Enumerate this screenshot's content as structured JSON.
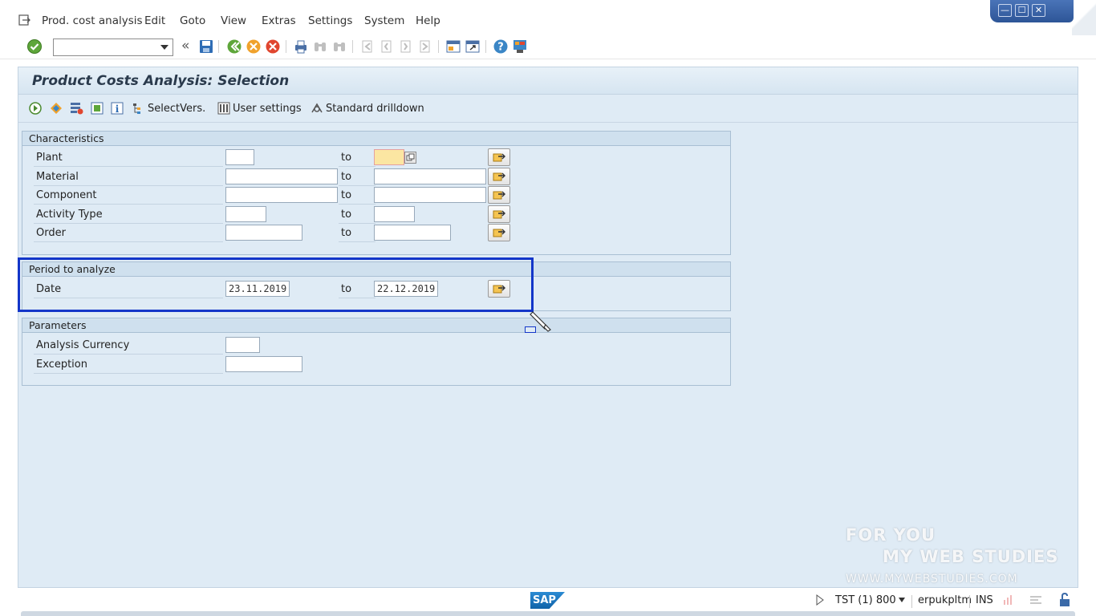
{
  "menu": {
    "items": [
      "Prod. cost analysis",
      "Edit",
      "Goto",
      "View",
      "Extras",
      "Settings",
      "System",
      "Help"
    ]
  },
  "window_controls": {
    "minimize": "—",
    "maximize": "☐",
    "close": "✕"
  },
  "toolbar": {
    "command_field_value": "",
    "back_nav_glyph": "«",
    "icons": [
      "enter-check-icon",
      "save-icon",
      "back-icon",
      "exit-icon",
      "cancel-icon",
      "print-icon",
      "find-icon",
      "find-next-icon",
      "first-page-icon",
      "prev-page-icon",
      "next-page-icon",
      "last-page-icon",
      "create-session-icon",
      "shortcut-icon",
      "help-icon",
      "layout-icon"
    ]
  },
  "page": {
    "title": "Product Costs Analysis: Selection"
  },
  "app_toolbar": {
    "select_versions_label": "SelectVers.",
    "user_settings_label": "User settings",
    "standard_drilldown_label": "Standard drilldown"
  },
  "characteristics": {
    "title": "Characteristics",
    "rows": [
      {
        "label": "Plant",
        "from": "",
        "to": ""
      },
      {
        "label": "Material",
        "from": "",
        "to": ""
      },
      {
        "label": "Component",
        "from": "",
        "to": ""
      },
      {
        "label": "Activity Type",
        "from": "",
        "to": ""
      },
      {
        "label": "Order",
        "from": "",
        "to": ""
      }
    ]
  },
  "period": {
    "title": "Period to analyze",
    "label": "Date",
    "from": "23.11.2019",
    "to": "22.12.2019"
  },
  "parameters": {
    "title": "Parameters",
    "rows": [
      {
        "label": "Analysis Currency",
        "value": ""
      },
      {
        "label": "Exception",
        "value": ""
      }
    ]
  },
  "to_label": "to",
  "status_bar": {
    "logo": "SAP",
    "system": "TST (1) 800",
    "user": "erpukpltm",
    "mode": "INS"
  },
  "watermark": {
    "line1": "FOR YOU",
    "line2": "MY WEB STUDIES",
    "line3": "WWW.MYWEBSTUDIES.COM"
  },
  "colors": {
    "highlight_box": "#1336c9",
    "frame_bg": "#dfebf5",
    "required_field": "#fbe6a2"
  }
}
